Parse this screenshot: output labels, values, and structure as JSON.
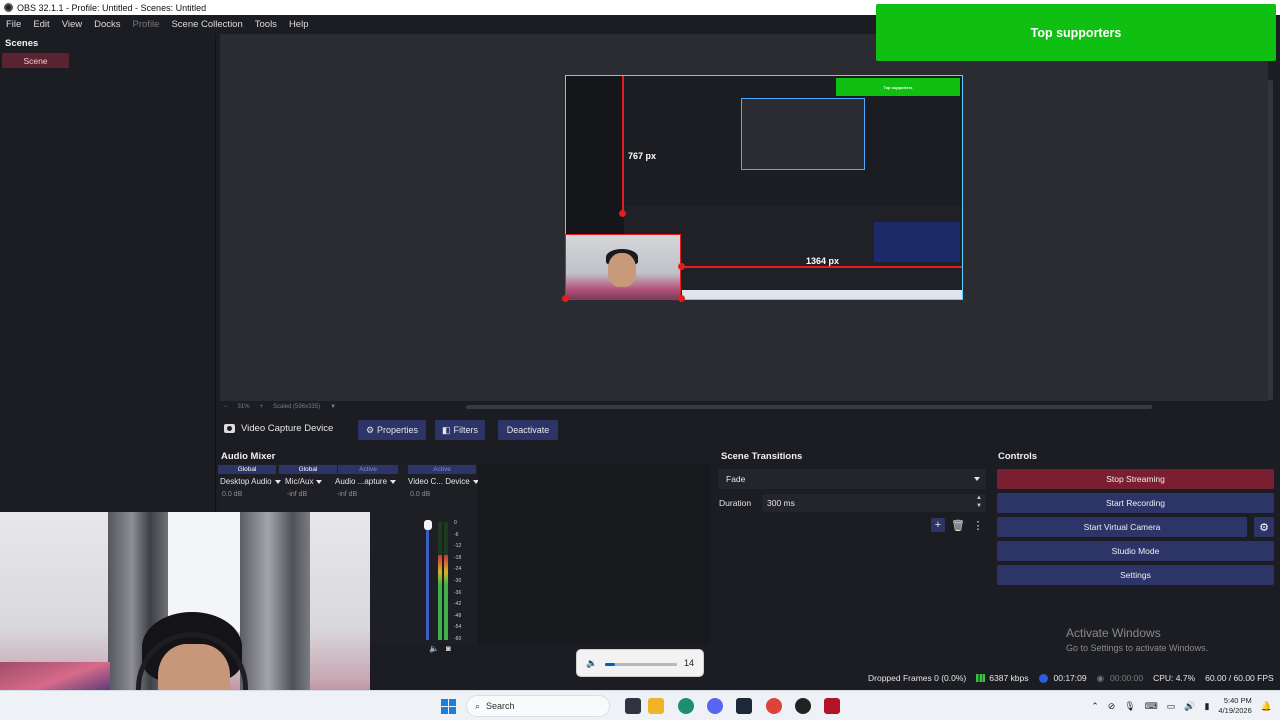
{
  "window": {
    "title": "OBS 32.1.1 - Profile: Untitled - Scenes: Untitled"
  },
  "menu": {
    "items": [
      "File",
      "Edit",
      "View",
      "Docks",
      "Profile",
      "Scene Collection",
      "Tools",
      "Help"
    ],
    "disabled_item": "Profile"
  },
  "overlay": {
    "supporters_title": "Top supporters"
  },
  "scenes": {
    "title": "Scenes",
    "items": [
      "Scene"
    ]
  },
  "preview": {
    "guide_vertical_label": "767 px",
    "guide_horizontal_label": "1364 px",
    "zoom_label": "31%",
    "scale_label": "Scaled (596x335)"
  },
  "source_toolbar": {
    "source_name": "Video Capture Device",
    "properties_label": "Properties",
    "filters_label": "Filters",
    "deactivate_label": "Deactivate"
  },
  "audio_mixer": {
    "title": "Audio Mixer",
    "channels": [
      {
        "status": "Global",
        "name": "Desktop Audio",
        "db": "0.0 dB",
        "level": 0.0
      },
      {
        "status": "Global",
        "name": "Mic/Aux",
        "db": "-inf dB",
        "level": 0.0
      },
      {
        "status": "Active",
        "name": "Audio ...apture",
        "db": "-inf dB",
        "level": 0.0
      },
      {
        "status": "Active",
        "name": "Video C... Device",
        "db": "0.0 dB",
        "level": 0.72
      }
    ],
    "scale_ticks": [
      "0",
      "-6",
      "-12",
      "-18",
      "-24",
      "-30",
      "-36",
      "-42",
      "-48",
      "-54",
      "-60"
    ]
  },
  "scene_transitions": {
    "title": "Scene Transitions",
    "transition": "Fade",
    "duration_label": "Duration",
    "duration_value": "300 ms"
  },
  "controls": {
    "title": "Controls",
    "stop_streaming": "Stop Streaming",
    "start_recording": "Start Recording",
    "start_virtual_camera": "Start Virtual Camera",
    "studio_mode": "Studio Mode",
    "settings": "Settings",
    "watermark_title": "Activate Windows",
    "watermark_sub": "Go to Settings to activate Windows."
  },
  "status_bar": {
    "dropped_frames": "Dropped Frames 0 (0.0%)",
    "bitrate": "6387 kbps",
    "stream_time": "00:17:09",
    "record_time": "00:00:00",
    "cpu": "CPU: 4.7%",
    "fps": "60.00 / 60.00 FPS"
  },
  "volume_popup": {
    "value": "14",
    "level": 0.14
  },
  "taskbar": {
    "search_placeholder": "Search",
    "time": "5:40 PM",
    "date": "4/19/2026"
  },
  "colors": {
    "accent_blue": "#2d3468",
    "stop_red": "#7a1f32",
    "supporters_green": "#0fbf12",
    "guide_red": "#e31c1c"
  }
}
